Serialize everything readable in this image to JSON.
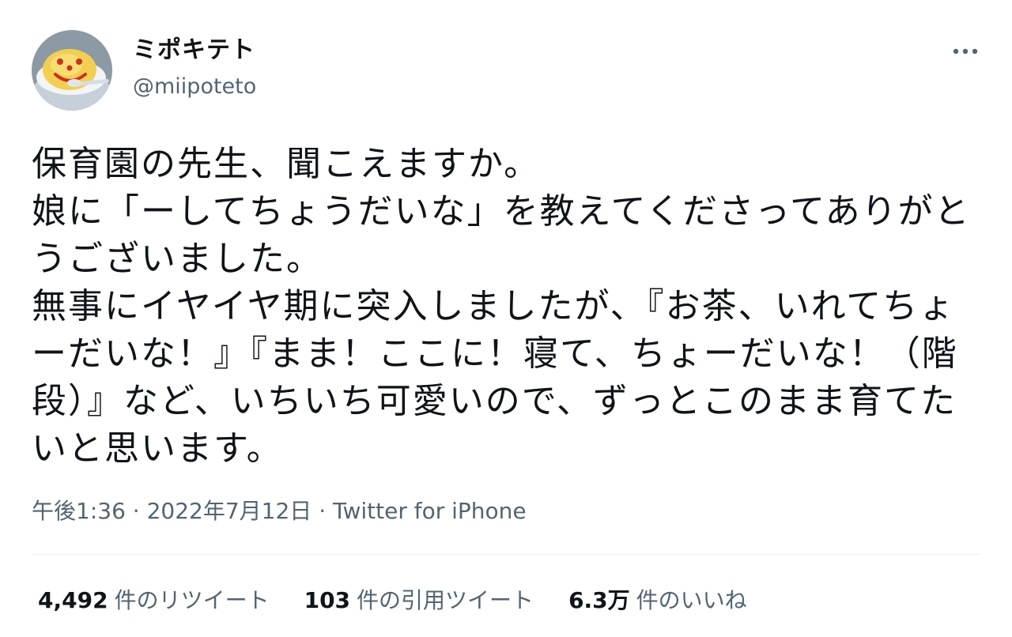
{
  "user": {
    "display_name": "ミポキテト",
    "handle": "@miipoteto"
  },
  "tweet": {
    "text": "保育園の先生、聞こえますか。\n娘に「ーしてちょうだいな」を教えてくださってありがとうございました。\n無事にイヤイヤ期に突入しましたが、『お茶、いれてちょーだいな！』『まま！ここに！寝て、ちょーだいな！（階段）』など、いちいち可愛いので、ずっとこのまま育てたいと思います。",
    "time": "午後1:36",
    "date": "2022年7月12日",
    "source": "Twitter for iPhone",
    "separator": " · "
  },
  "stats": {
    "retweets": {
      "count": "4,492",
      "label": "件のリツイート"
    },
    "quotes": {
      "count": "103",
      "label": "件の引用ツイート"
    },
    "likes": {
      "count": "6.3万",
      "label": "件のいいね"
    }
  },
  "icons": {
    "more": "more-horizontal-icon",
    "avatar": "omelette-smiley-avatar"
  },
  "colors": {
    "text_primary": "#0f1419",
    "text_secondary": "#536471",
    "divider": "#eff3f4",
    "background": "#ffffff"
  }
}
